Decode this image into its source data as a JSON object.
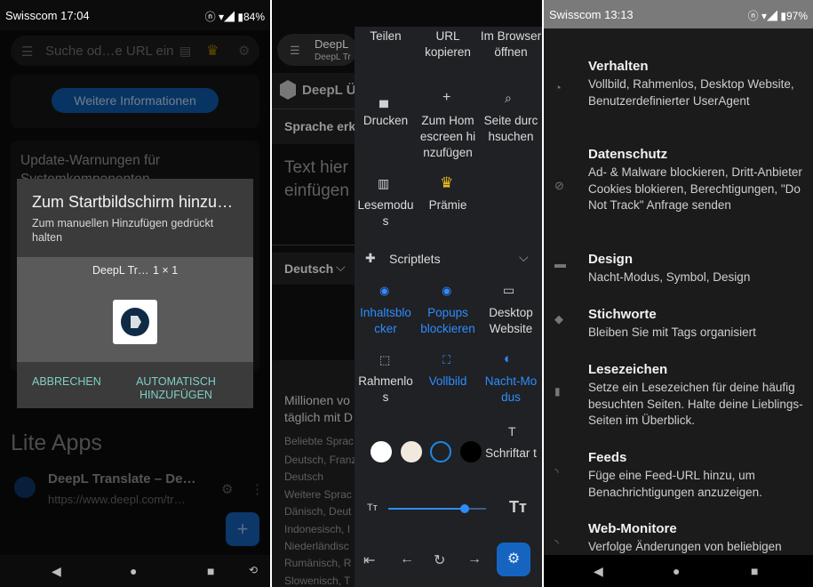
{
  "panel1": {
    "status": {
      "time": "Swisscom 17:04",
      "battery": "84%"
    },
    "url_placeholder": "Suche od…e URL ein",
    "more_info_button": "Weitere Informationen",
    "card2_title": "Update-Warnungen für Systemkomponenten",
    "dialog": {
      "title": "Zum Startbildschirm hinzu…",
      "subtitle": "Zum manuellen Hinzufügen gedrückt halten",
      "app_label": "DeepL Tr…",
      "size": "1 × 1",
      "cancel": "ABBRECHEN",
      "auto_add": "AUTOMATISCH HINZUFÜGEN"
    },
    "lite_apps_title": "Lite Apps",
    "lite_app": {
      "name": "DeepL Translate – De…",
      "url": "https://www.deepl.com/tr…"
    },
    "fab": "+"
  },
  "panel2": {
    "bg": {
      "tab_title": "DeepL",
      "tab_sub": "DeepL Tr",
      "logo_text": "DeepL Ü",
      "source_lang_label": "Sprache erk",
      "input_placeholder": "Text hier einfügen",
      "lang_select": "Deutsch",
      "millions_text": "Millionen vo täglich mit D",
      "popular_label": "Beliebte Sprac",
      "lang_list": [
        "Deutsch, Franz",
        "Deutsch",
        "Weitere Sprac",
        "Dänisch, Deut",
        "Indonesisch, I",
        "Niederländisc",
        "Rumänisch, R",
        "Slowenisch, T"
      ]
    },
    "menu": {
      "row1": [
        "Teilen",
        "URL kopieren",
        "Im Browser öffnen"
      ],
      "row2": [
        "Drucken",
        "Zum Hom escreen hi nzufügen",
        "Seite durc hsuchen"
      ],
      "row3": [
        "Lesemodu s",
        "Prämie"
      ],
      "scriptlets": "Scriptlets",
      "row4": [
        "Inhaltsblo cker",
        "Popups blockieren",
        "Desktop Website"
      ],
      "row5": [
        "Rahmenlo s",
        "Vollbild",
        "Nacht-Mo dus"
      ],
      "font_label": "Schriftar t",
      "colors": [
        "#ffffff",
        "#f1e9dd",
        "#1e88e5",
        "#000000"
      ],
      "slider_level": 0.78
    }
  },
  "panel3": {
    "status": {
      "time": "Swisscom 13:13",
      "battery": "97%"
    },
    "settings": [
      {
        "title": "Verhalten",
        "desc": "Vollbild, Rahmenlos, Desktop Website, Benutzerdefinierter UserAgent",
        "icon": "speedometer-icon"
      },
      {
        "title": "Datenschutz",
        "desc": "Ad- & Malware blockieren, Dritt-Anbieter Cookies blokieren, Berechtigungen, \"Do Not Track\" Anfrage senden",
        "icon": "eye-off-icon"
      },
      {
        "title": "Design",
        "desc": "Nacht-Modus, Symbol, Design",
        "icon": "paint-roller-icon"
      },
      {
        "title": "Stichworte",
        "desc": "Bleiben Sie mit Tags organisiert",
        "icon": "tag-icon"
      },
      {
        "title": "Lesezeichen",
        "desc": "Setze ein Lesezeichen für deine häufig besuchten Seiten. Halte deine Lieblings-Seiten im Überblick.",
        "icon": "bookmark-icon"
      },
      {
        "title": "Feeds",
        "desc": "Füge eine Feed-URL hinzu, um Benachrichtigungen anzuzeigen.",
        "icon": "rss-icon"
      },
      {
        "title": "Web-Monitore",
        "desc": "Verfolge Änderungen von beliebigen",
        "icon": "rss-icon"
      }
    ]
  }
}
